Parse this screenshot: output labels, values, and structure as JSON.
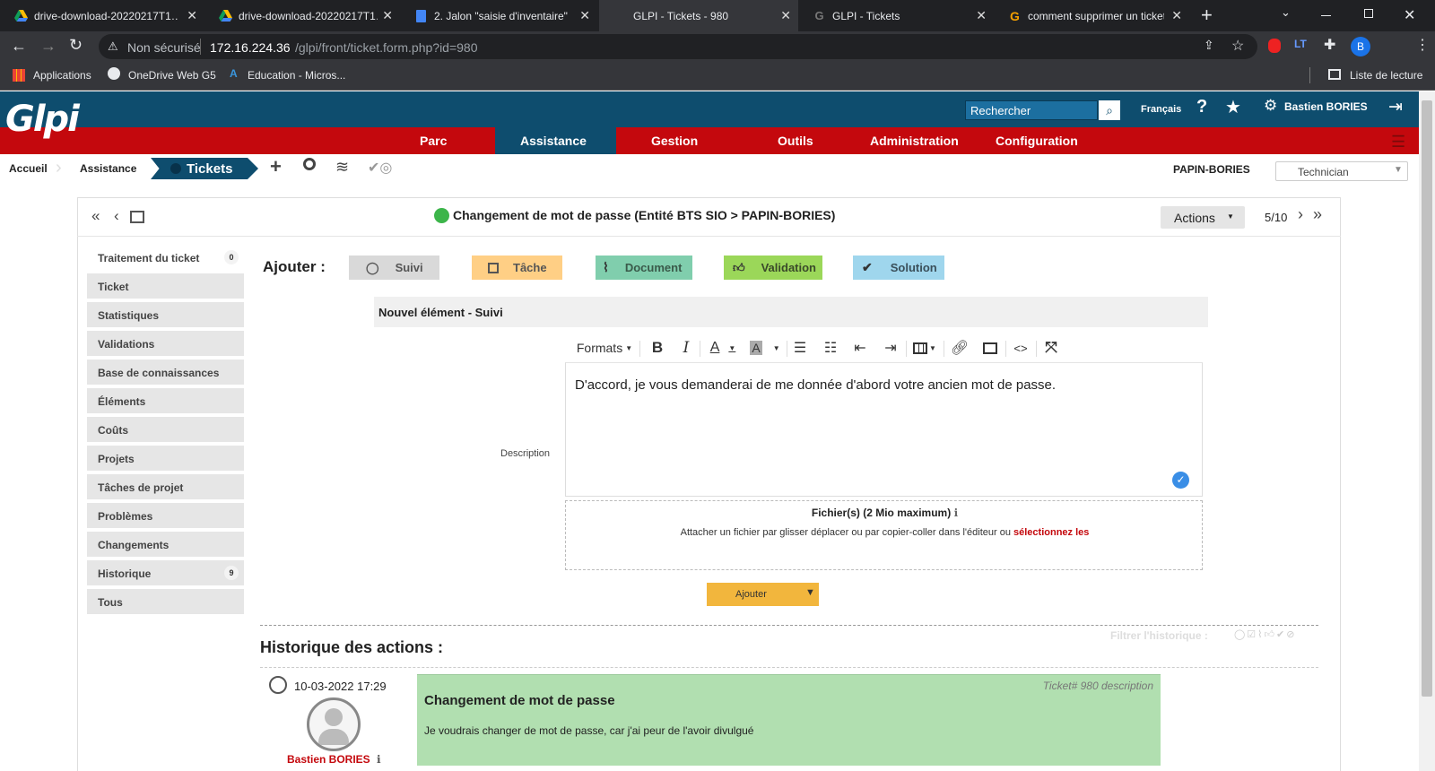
{
  "browser": {
    "tabs": [
      {
        "title": "drive-download-20220217T1…",
        "active": false
      },
      {
        "title": "drive-download-20220217T1…",
        "active": false
      },
      {
        "title": "2. Jalon \"saisie d'inventaire\" -",
        "active": false
      },
      {
        "title": "GLPI - Tickets - 980",
        "active": true
      },
      {
        "title": "GLPI - Tickets",
        "active": false
      },
      {
        "title": "comment supprimer un ticket",
        "active": false
      }
    ],
    "security": "Non sécurisé",
    "url_host": "172.16.224.36",
    "url_path": "/glpi/front/ticket.form.php?id=980",
    "profile_letter": "B",
    "bookmarks": [
      "Applications",
      "OneDrive Web G5",
      "Education - Micros..."
    ],
    "reading_list": "Liste de lecture"
  },
  "header": {
    "logo": "Glpi",
    "search_placeholder": "Rechercher",
    "language": "Français",
    "user": "Bastien BORIES"
  },
  "menu": [
    "Parc",
    "Assistance",
    "Gestion",
    "Outils",
    "Administration",
    "Configuration"
  ],
  "breadcrumb": {
    "home": "Accueil",
    "section": "Assistance",
    "current": "Tickets",
    "entity": "PAPIN-BORIES",
    "profile": "Technician"
  },
  "ticket": {
    "title": "Changement de mot de passe (Entité BTS SIO > PAPIN-BORIES)",
    "actions_label": "Actions",
    "pager": "5/10"
  },
  "sidebar": [
    {
      "label": "Traitement du ticket",
      "count": "0"
    },
    {
      "label": "Ticket",
      "count": ""
    },
    {
      "label": "Statistiques",
      "count": ""
    },
    {
      "label": "Validations",
      "count": ""
    },
    {
      "label": "Base de connaissances",
      "count": ""
    },
    {
      "label": "Éléments",
      "count": ""
    },
    {
      "label": "Coûts",
      "count": ""
    },
    {
      "label": "Projets",
      "count": ""
    },
    {
      "label": "Tâches de projet",
      "count": ""
    },
    {
      "label": "Problèmes",
      "count": ""
    },
    {
      "label": "Changements",
      "count": ""
    },
    {
      "label": "Historique",
      "count": "9"
    },
    {
      "label": "Tous",
      "count": ""
    }
  ],
  "add": {
    "label": "Ajouter :",
    "buttons": [
      {
        "label": "Suivi",
        "color": "#d9d9d9"
      },
      {
        "label": "Tâche",
        "color": "#ffcf85"
      },
      {
        "label": "Document",
        "color": "#80cead"
      },
      {
        "label": "Validation",
        "color": "#9bd759"
      },
      {
        "label": "Solution",
        "color": "#9fd6ed"
      }
    ]
  },
  "form": {
    "title": "Nouvel élément - Suivi",
    "formats": "Formats",
    "description_label": "Description",
    "content": "D'accord, je vous demanderai de me donnée d'abord votre ancien mot de passe.",
    "files_label": "Fichier(s) (2 Mio maximum)",
    "attach_text": "Attacher un fichier par glisser déplacer ou par copier-coller dans l'éditeur ou ",
    "attach_link": "sélectionnez les",
    "submit": "Ajouter"
  },
  "history": {
    "title": "Historique des actions :",
    "filter": "Filtrer l'historique :",
    "date": "10-03-2022 17:29",
    "author": "Bastien BORIES",
    "ref": "Ticket# 980 description",
    "item_title": "Changement de mot de passe",
    "item_text": "Je voudrais changer de mot de passe, car j'ai peur de l'avoir divulgué"
  },
  "colors": {
    "header": "#0e4d6e",
    "menu": "#c4080d",
    "followup": "#b1dfb0"
  }
}
